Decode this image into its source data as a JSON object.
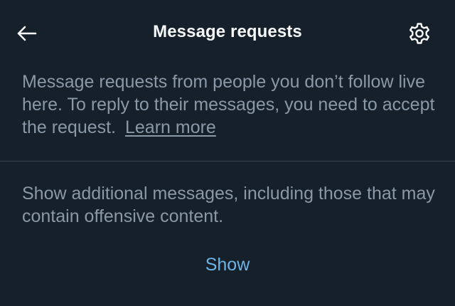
{
  "header": {
    "title": "Message requests",
    "back_icon": "arrow-left-icon",
    "settings_icon": "gear-icon"
  },
  "info": {
    "text": "Message requests from people you don’t follow live here. To reply to their messages, you need to accept the request.",
    "learn_more_label": "Learn more"
  },
  "additional": {
    "text": "Show additional messages, including those that may contain offensive content.",
    "show_label": "Show"
  },
  "colors": {
    "background": "#15202b",
    "primary_text": "#f7f9f9",
    "secondary_text": "#8b98a5",
    "divider": "#38444d",
    "accent": "#6cb4e6"
  }
}
